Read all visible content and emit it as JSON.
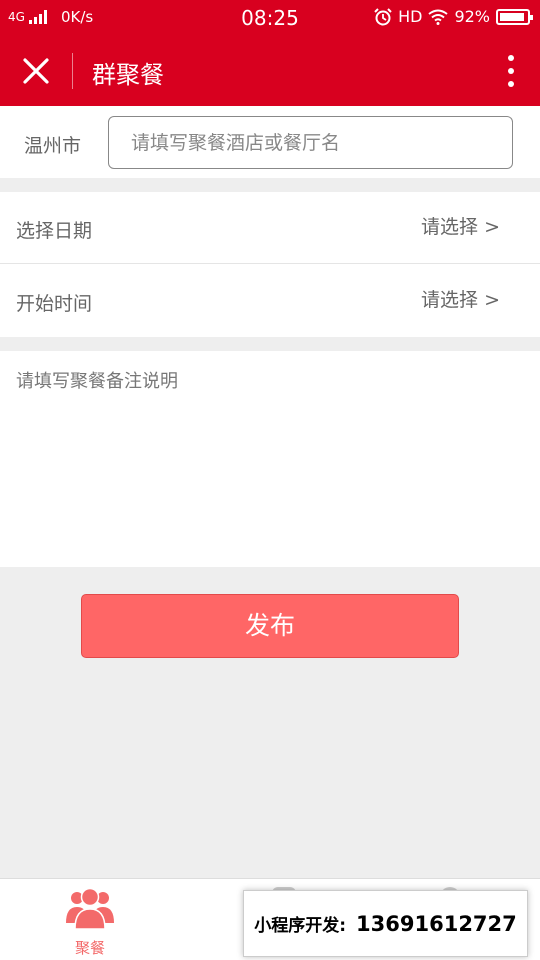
{
  "status_bar": {
    "network": "4G",
    "speed": "0K/s",
    "time": "08:25",
    "hd": "HD",
    "battery": "92%",
    "battery_level": 0.92
  },
  "nav": {
    "title": "群聚餐"
  },
  "search": {
    "city": "温州市",
    "placeholder": "请填写聚餐酒店或餐厅名",
    "value": ""
  },
  "pickers": [
    {
      "label": "选择日期",
      "value": "请选择 >"
    },
    {
      "label": "开始时间",
      "value": "请选择 >"
    }
  ],
  "remark": {
    "placeholder": "请填写聚餐备注说明"
  },
  "publish": {
    "label": "发布"
  },
  "tabs": [
    {
      "label": "聚餐",
      "icon": "group-icon"
    }
  ],
  "watermark": {
    "prefix": "小程序开发:",
    "phone": "13691612727"
  },
  "colors": {
    "brand": "#d8001f",
    "button": "#ff6666",
    "tab_active": "#f36a6a"
  }
}
